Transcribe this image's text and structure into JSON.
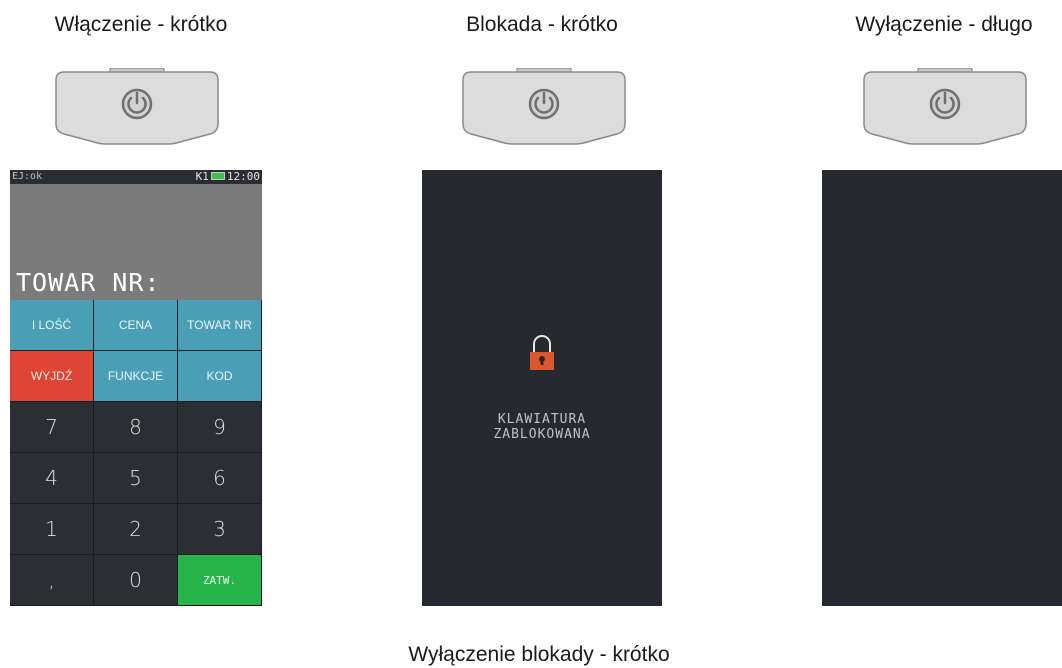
{
  "captions": {
    "power_on": "Włączenie - krótko",
    "lock": "Blokada - krótko",
    "power_off": "Wyłączenie - długo",
    "unlock": "Wyłączenie blokady - krótko"
  },
  "phone_screen": {
    "status_left": "EJ:ok",
    "status_right_prefix": "K1",
    "status_time": "12:00",
    "prompt": "TOWAR NR:",
    "keys": [
      {
        "label": "I LOŚĆ",
        "style": "blue"
      },
      {
        "label": "CENA",
        "style": "blue"
      },
      {
        "label": "TOWAR NR",
        "style": "blue"
      },
      {
        "label": "WYJDŹ",
        "style": "red"
      },
      {
        "label": "FUNKCJE",
        "style": "blue"
      },
      {
        "label": "KOD",
        "style": "blue"
      },
      {
        "label": "7",
        "style": "dark"
      },
      {
        "label": "8",
        "style": "dark"
      },
      {
        "label": "9",
        "style": "dark"
      },
      {
        "label": "4",
        "style": "dark"
      },
      {
        "label": "5",
        "style": "dark"
      },
      {
        "label": "6",
        "style": "dark"
      },
      {
        "label": "1",
        "style": "dark"
      },
      {
        "label": "2",
        "style": "dark"
      },
      {
        "label": "3",
        "style": "dark"
      },
      {
        "label": ",",
        "style": "dark"
      },
      {
        "label": "0",
        "style": "dark"
      },
      {
        "label": "ZATW.",
        "style": "green"
      }
    ]
  },
  "locked_screen": {
    "icon": "padlock-icon",
    "line1": "KLAWIATURA",
    "line2": "ZABLOKOWANA"
  },
  "colors": {
    "key_blue": "#4a9fb6",
    "key_red": "#df4534",
    "key_green": "#27b44b",
    "key_dark": "#2b2f33",
    "screen_dark": "#262a2e",
    "lock_orange": "#d9582f"
  }
}
